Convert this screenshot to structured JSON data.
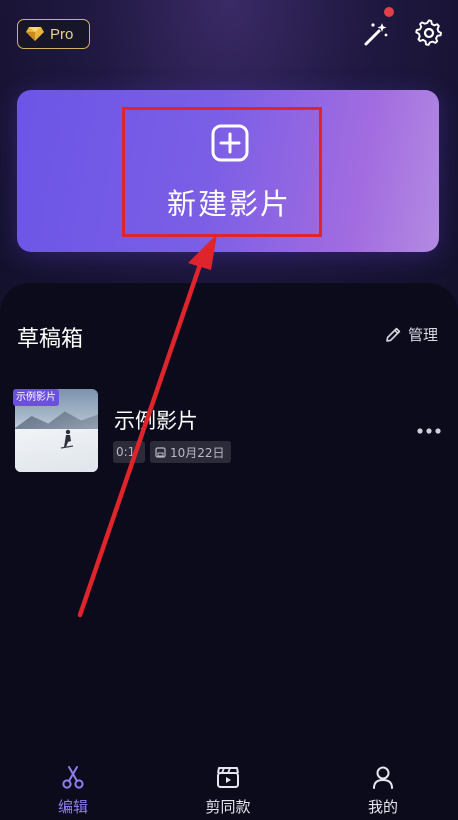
{
  "header": {
    "pro_badge": "Pro",
    "icons": [
      "diamond-icon",
      "magic-wand-icon",
      "gear-icon"
    ],
    "notification_dot": true
  },
  "new_project": {
    "label": "新建影片",
    "icon": "plus-square-icon"
  },
  "drafts": {
    "title": "草稿箱",
    "manage_label": "管理",
    "items": [
      {
        "tag": "示例影片",
        "name": "示例影片",
        "duration": "0:1",
        "date": "10月22日"
      }
    ]
  },
  "bottom_nav": {
    "items": [
      {
        "label": "编辑",
        "icon": "scissors-icon",
        "active": true
      },
      {
        "label": "剪同款",
        "icon": "clapperboard-icon",
        "active": false
      },
      {
        "label": "我的",
        "icon": "user-icon",
        "active": false
      }
    ]
  },
  "colors": {
    "accent": "#7a5ee6",
    "active_nav": "#8f7df0",
    "highlight_box": "#e0242c",
    "pro_gold": "#d7b25a",
    "background": "#0b0b1c"
  }
}
